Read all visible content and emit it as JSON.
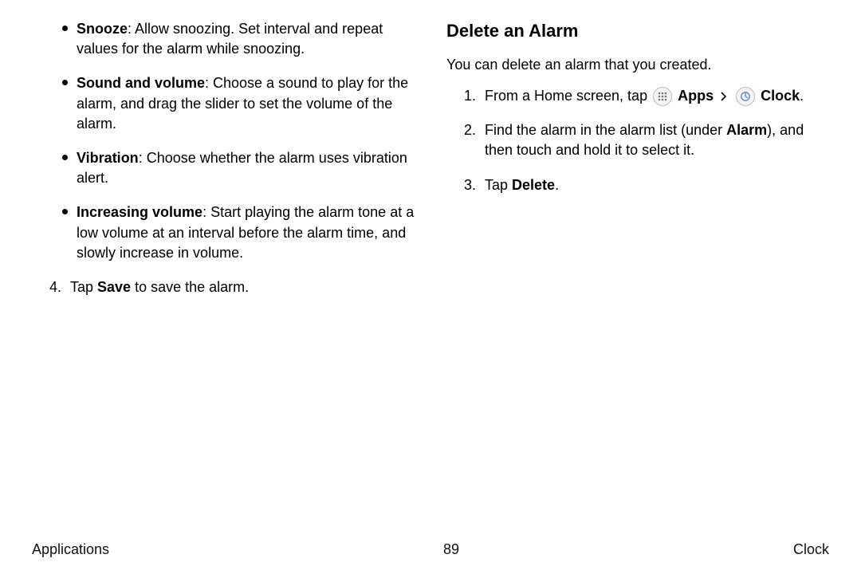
{
  "left": {
    "bullets": [
      {
        "term": "Snooze",
        "desc": ": Allow snoozing. Set interval and repeat values for the alarm while snoozing."
      },
      {
        "term": "Sound and volume",
        "desc": ": Choose a sound to play for the alarm, and drag the slider to set the volume of the alarm."
      },
      {
        "term": "Vibration",
        "desc": ": Choose whether the alarm uses vibration alert."
      },
      {
        "term": "Increasing volume",
        "desc": ": Start playing the alarm tone at a low volume at an interval before the alarm time, and slowly increase in volume."
      }
    ],
    "step4": {
      "num": "4.",
      "pre": "Tap ",
      "bold": "Save",
      "post": " to save the alarm."
    }
  },
  "right": {
    "heading": "Delete an Alarm",
    "intro": "You can delete an alarm that you created.",
    "step1": {
      "num": "1.",
      "pre": "From a Home screen, tap ",
      "apps": "Apps",
      "clock": "Clock",
      "post": "."
    },
    "step2": {
      "num": "2.",
      "pre": "Find the alarm in the alarm list (under ",
      "bold": "Alarm",
      "post": "), and then touch and hold it to select it."
    },
    "step3": {
      "num": "3.",
      "pre": "Tap ",
      "bold": "Delete",
      "post": "."
    }
  },
  "footer": {
    "left": "Applications",
    "center": "89",
    "right": "Clock"
  }
}
